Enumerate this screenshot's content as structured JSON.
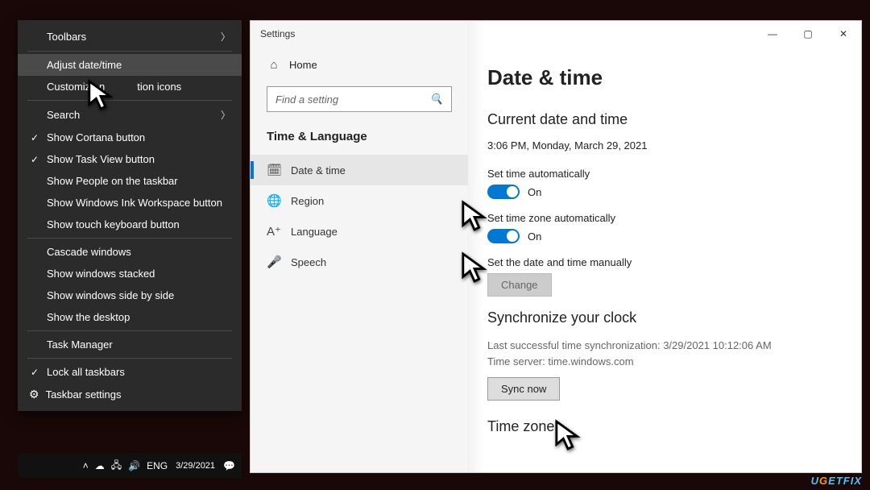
{
  "context_menu": {
    "toolbars": "Toolbars",
    "adjust": "Adjust date/time",
    "customize_left": "Customize n",
    "customize_right": "tion icons",
    "search": "Search",
    "show_cortana": "Show Cortana button",
    "show_taskview": "Show Task View button",
    "show_people": "Show People on the taskbar",
    "show_ink": "Show Windows Ink Workspace button",
    "show_touchkb": "Show touch keyboard button",
    "cascade": "Cascade windows",
    "stacked": "Show windows stacked",
    "sidebyside": "Show windows side by side",
    "desktop": "Show the desktop",
    "task_manager": "Task Manager",
    "lock": "Lock all taskbars",
    "settings": "Taskbar settings"
  },
  "taskbar": {
    "lang": "ENG",
    "time": "",
    "date": "3/29/2021"
  },
  "settings_window": {
    "title": "Settings",
    "home": "Home",
    "search_placeholder": "Find a setting",
    "section": "Time & Language",
    "nav": {
      "datetime": "Date & time",
      "region": "Region",
      "language": "Language",
      "speech": "Speech"
    },
    "main": {
      "h1": "Date & time",
      "current_heading": "Current date and time",
      "current_value": "3:06 PM, Monday, March 29, 2021",
      "set_time_auto_label": "Set time automatically",
      "set_time_auto_state": "On",
      "set_tz_auto_label": "Set time zone automatically",
      "set_tz_auto_state": "On",
      "set_manual_label": "Set the date and time manually",
      "change_button": "Change",
      "sync_heading": "Synchronize your clock",
      "sync_last": "Last successful time synchronization: 3/29/2021 10:12:06 AM",
      "sync_server": "Time server: time.windows.com",
      "sync_button": "Sync now",
      "timezone_heading": "Time zone"
    }
  },
  "watermark": "UGETFIX"
}
